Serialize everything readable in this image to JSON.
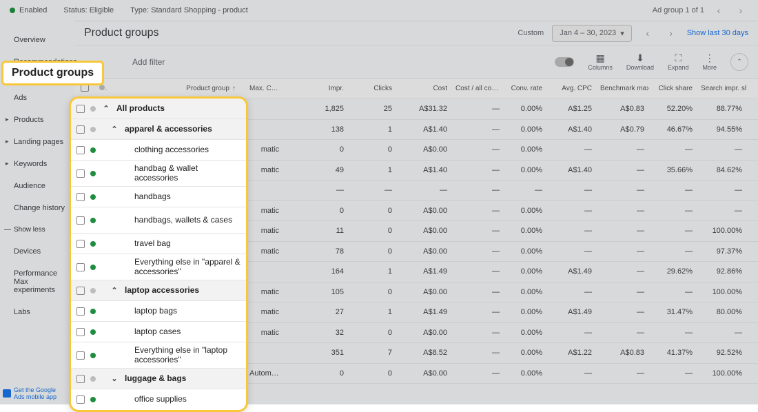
{
  "topbar": {
    "enabled": "Enabled",
    "status_label": "Status:",
    "status_value": "Eligible",
    "type_label": "Type:",
    "type_value": "Standard Shopping - product",
    "adgroup": "Ad group 1 of 1"
  },
  "leftnav": {
    "items": [
      "Overview",
      "Recommendations",
      "",
      "Ads",
      "Products",
      "Landing pages",
      "Keywords",
      "Audience",
      "Change history"
    ],
    "show_less": "Show less",
    "sub": [
      "Devices",
      "Performance Max experiments",
      "Labs"
    ],
    "promo1": "Get the Google",
    "promo2": "Ads mobile app"
  },
  "header": {
    "title": "Product groups",
    "custom": "Custom",
    "date": "Jan 4 – 30, 2023",
    "show_last": "Show last 30 days"
  },
  "toolbar": {
    "add_filter": "Add filter",
    "columns": "Columns",
    "download": "Download",
    "expand": "Expand",
    "more": "More"
  },
  "table": {
    "headers": {
      "product_group": "Product group",
      "max_cpc": "Max. CPC",
      "impr": "Impr.",
      "clicks": "Clicks",
      "cost": "Cost",
      "cost_all": "Cost / all conv.",
      "conv_rate": "Conv. rate",
      "avg_cpc": "Avg. CPC",
      "bench": "Benchmark max. CPC",
      "click_share": "Click share",
      "sis": "Search impr. share"
    },
    "rows": [
      {
        "name": "All products",
        "max": "",
        "impr": "1,825",
        "clicks": "25",
        "cost": "A$31.32",
        "cac": "—",
        "conv": "0.00%",
        "avg": "A$1.25",
        "bmc": "A$0.83",
        "csh": "52.20%",
        "sis": "88.77%",
        "status": "gr"
      },
      {
        "name": "apparel & accessories",
        "max": "",
        "impr": "138",
        "clicks": "1",
        "cost": "A$1.40",
        "cac": "—",
        "conv": "0.00%",
        "avg": "A$1.40",
        "bmc": "A$0.79",
        "csh": "46.67%",
        "sis": "94.55%",
        "status": "gr"
      },
      {
        "name": "clothing accessories",
        "max": "matic",
        "impr": "0",
        "clicks": "0",
        "cost": "A$0.00",
        "cac": "—",
        "conv": "0.00%",
        "avg": "—",
        "bmc": "—",
        "csh": "—",
        "sis": "—",
        "status": "g"
      },
      {
        "name": "handbag & wallet acc.",
        "max": "matic",
        "impr": "49",
        "clicks": "1",
        "cost": "A$1.40",
        "cac": "—",
        "conv": "0.00%",
        "avg": "A$1.40",
        "bmc": "—",
        "csh": "35.66%",
        "sis": "84.62%",
        "status": "g"
      },
      {
        "name": "handbags",
        "max": "",
        "impr": "—",
        "clicks": "—",
        "cost": "—",
        "cac": "—",
        "conv": "—",
        "avg": "—",
        "bmc": "—",
        "csh": "—",
        "sis": "—",
        "status": "g"
      },
      {
        "name": "handbags, wallets & cases",
        "max": "matic",
        "impr": "0",
        "clicks": "0",
        "cost": "A$0.00",
        "cac": "—",
        "conv": "0.00%",
        "avg": "—",
        "bmc": "—",
        "csh": "—",
        "sis": "—",
        "status": "g"
      },
      {
        "name": "travel bag",
        "max": "matic",
        "impr": "11",
        "clicks": "0",
        "cost": "A$0.00",
        "cac": "—",
        "conv": "0.00%",
        "avg": "—",
        "bmc": "—",
        "csh": "—",
        "sis": "100.00%",
        "status": "g"
      },
      {
        "name": "Everything else apparel",
        "max": "matic",
        "impr": "78",
        "clicks": "0",
        "cost": "A$0.00",
        "cac": "—",
        "conv": "0.00%",
        "avg": "—",
        "bmc": "—",
        "csh": "—",
        "sis": "97.37%",
        "status": "g"
      },
      {
        "name": "laptop accessories",
        "max": "",
        "impr": "164",
        "clicks": "1",
        "cost": "A$1.49",
        "cac": "—",
        "conv": "0.00%",
        "avg": "A$1.49",
        "bmc": "—",
        "csh": "29.62%",
        "sis": "92.86%",
        "status": "gr"
      },
      {
        "name": "laptop bags",
        "max": "matic",
        "impr": "105",
        "clicks": "0",
        "cost": "A$0.00",
        "cac": "—",
        "conv": "0.00%",
        "avg": "—",
        "bmc": "—",
        "csh": "—",
        "sis": "100.00%",
        "status": "g"
      },
      {
        "name": "laptop cases",
        "max": "matic",
        "impr": "27",
        "clicks": "1",
        "cost": "A$1.49",
        "cac": "—",
        "conv": "0.00%",
        "avg": "A$1.49",
        "bmc": "—",
        "csh": "31.47%",
        "sis": "80.00%",
        "status": "g"
      },
      {
        "name": "Everything else laptop",
        "max": "matic",
        "impr": "32",
        "clicks": "0",
        "cost": "A$0.00",
        "cac": "—",
        "conv": "0.00%",
        "avg": "—",
        "bmc": "—",
        "csh": "—",
        "sis": "—",
        "status": "g"
      },
      {
        "name": "luggage & bags",
        "max": "",
        "impr": "351",
        "clicks": "7",
        "cost": "A$8.52",
        "cac": "—",
        "conv": "0.00%",
        "avg": "A$1.22",
        "bmc": "A$0.83",
        "csh": "41.37%",
        "sis": "92.52%",
        "status": "gr"
      },
      {
        "name": "office supplies",
        "max": "Automatic",
        "impr": "0",
        "clicks": "0",
        "cost": "A$0.00",
        "cac": "—",
        "conv": "0.00%",
        "avg": "—",
        "bmc": "—",
        "csh": "—",
        "sis": "100.00%",
        "status": "g"
      }
    ]
  },
  "callout": {
    "tag": "Product groups"
  },
  "panel": [
    {
      "type": "parent",
      "chev": "up",
      "status": "gr",
      "label": "All products"
    },
    {
      "type": "parent",
      "chev": "up",
      "status": "gr",
      "label": "apparel & accessories",
      "indent": 1
    },
    {
      "type": "leaf",
      "status": "g",
      "label": "clothing accessories"
    },
    {
      "type": "leaf",
      "status": "g",
      "label": "handbag & wallet accessories",
      "tall": true
    },
    {
      "type": "leaf",
      "status": "g",
      "label": "handbags"
    },
    {
      "type": "leaf",
      "status": "g",
      "label": "handbags, wallets & cases",
      "tall": true
    },
    {
      "type": "leaf",
      "status": "g",
      "label": "travel bag"
    },
    {
      "type": "leaf",
      "status": "g",
      "label": "Everything else in \"apparel & accessories\"",
      "tall": true
    },
    {
      "type": "parent",
      "chev": "up",
      "status": "gr",
      "label": "laptop accessories",
      "indent": 1
    },
    {
      "type": "leaf",
      "status": "g",
      "label": "laptop bags"
    },
    {
      "type": "leaf",
      "status": "g",
      "label": "laptop cases"
    },
    {
      "type": "leaf",
      "status": "g",
      "label": "Everything else in \"laptop accessories\"",
      "tall": true
    },
    {
      "type": "parent",
      "chev": "down",
      "status": "gr",
      "label": "luggage & bags",
      "indent": 1
    },
    {
      "type": "leaf",
      "status": "g",
      "label": "office supplies"
    }
  ]
}
